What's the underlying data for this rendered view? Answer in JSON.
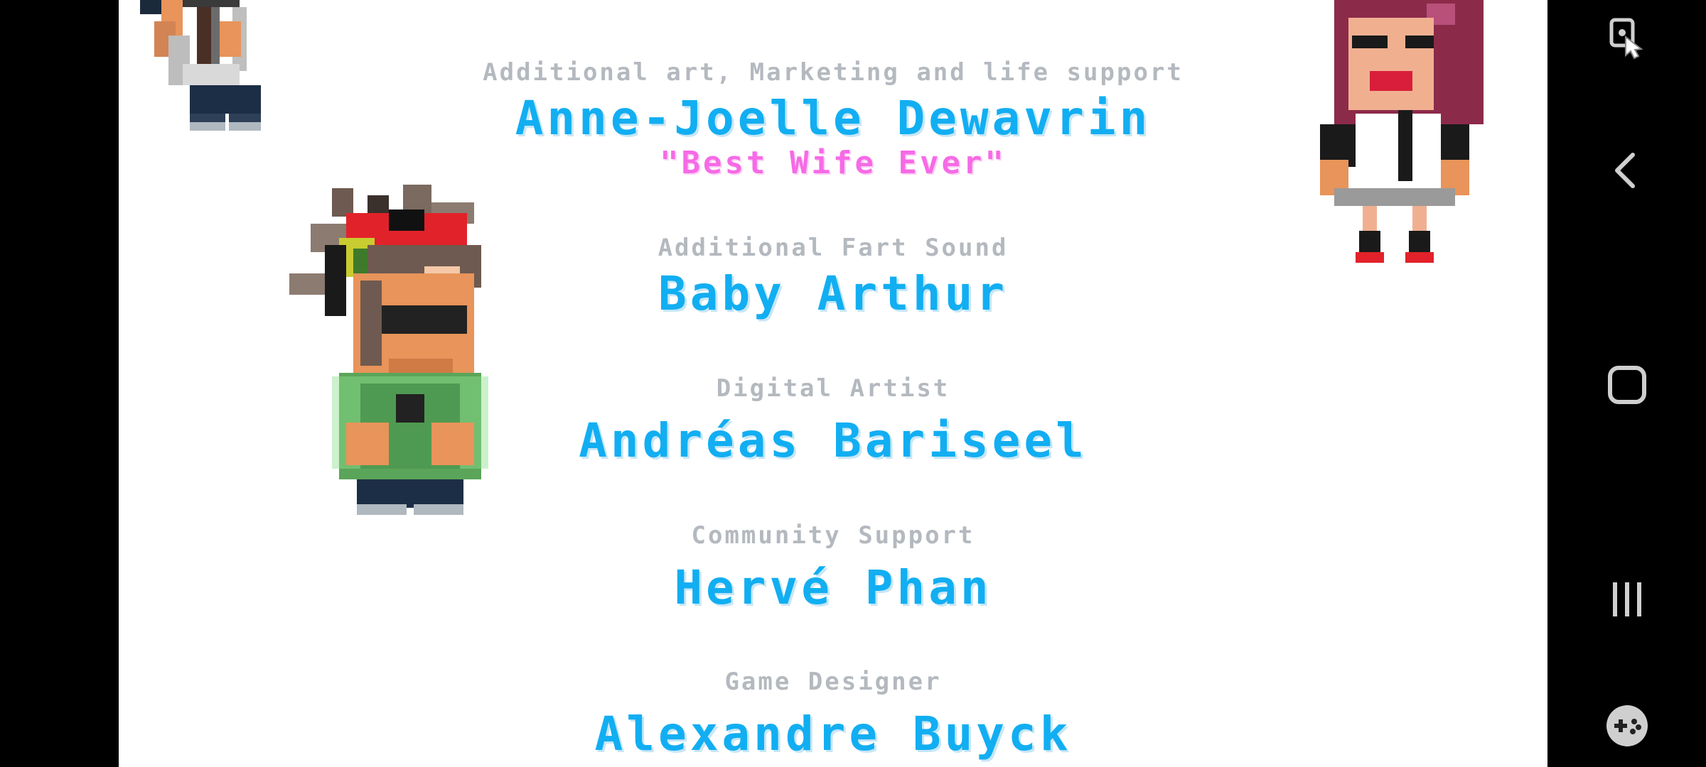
{
  "credits": [
    {
      "role": "Additional art, Marketing and life support",
      "name": "Anne-Joelle Dewavrin",
      "tagline": "\"Best Wife Ever\""
    },
    {
      "role": "Additional Fart Sound",
      "name": "Baby Arthur"
    },
    {
      "role": "Digital Artist",
      "name": "Andréas Bariseel"
    },
    {
      "role": "Community Support",
      "name": "Hervé Phan"
    },
    {
      "role": "Game Designer",
      "name": "Alexandre Buyck"
    }
  ],
  "icons": {
    "close": "close-icon",
    "screen_lock": "screen-lock-touch-icon",
    "back": "back-chevron-icon",
    "home": "home-square-icon",
    "recents": "recents-bars-icon",
    "game_tools": "gamepad-icon"
  },
  "colors": {
    "background": "#ffffff",
    "role_text": "#b4b9bf",
    "name_text": "#12aef2",
    "tagline_text": "#f66ae6"
  }
}
